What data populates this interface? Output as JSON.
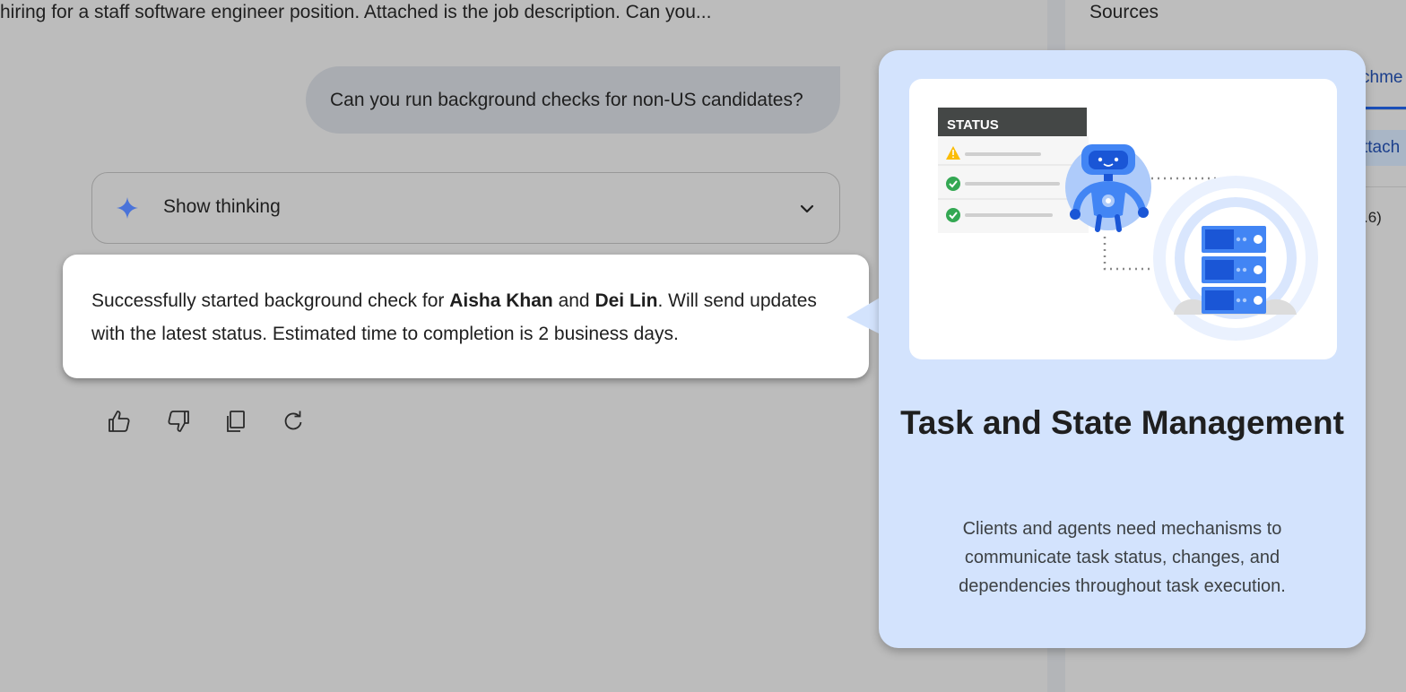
{
  "conversation": {
    "previous_prompt": "hiring for a staff software engineer position. Attached is the job description. Can you...",
    "user_message": "Can you run background checks for non-US candidates?",
    "thinking_label": "Show thinking",
    "response": {
      "part1": "Successfully started background check for ",
      "name1": "Aisha Khan",
      "part2": " and ",
      "name2": "Dei Lin",
      "part3": ". Will send updates with the latest status. Estimated time to completion is 2 business days."
    },
    "actions": [
      "thumbs-up-icon",
      "thumbs-down-icon",
      "copy-icon",
      "refresh-icon"
    ]
  },
  "side_panel": {
    "title": "Sources",
    "tab_peek": "chme",
    "chip_peek": "ttach",
    "count_peek": ".6)"
  },
  "feature_card": {
    "status_header": "STATUS",
    "title": "Task and State Management",
    "description": "Clients and agents need mechanisms to communicate task status, changes, and dependencies throughout task execution."
  },
  "colors": {
    "background": "#bcbcbc",
    "card": "#d3e3fd",
    "user_bubble": "#a9acb1",
    "accent_blue": "#4285f4",
    "check_green": "#34a853",
    "warning_yellow": "#fbbc04"
  }
}
